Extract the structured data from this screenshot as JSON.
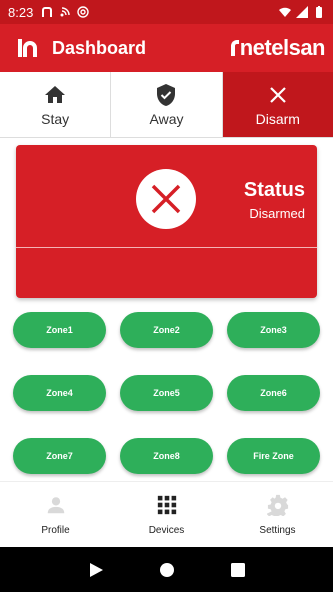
{
  "status_bar": {
    "time": "8:23",
    "left_icons": [
      "n-logo-icon",
      "wifi-small-icon",
      "at-sign-icon"
    ],
    "right_icons": [
      "wifi-icon",
      "signal-icon",
      "battery-icon"
    ]
  },
  "app_bar": {
    "title": "Dashboard",
    "brand": "netelsan",
    "colors": {
      "primary": "#d61f26",
      "dark": "#c0171c"
    }
  },
  "modes": [
    {
      "label": "Stay",
      "icon": "home-icon",
      "active": false
    },
    {
      "label": "Away",
      "icon": "shield-check-icon",
      "active": false
    },
    {
      "label": "Disarm",
      "icon": "close-icon",
      "active": true
    }
  ],
  "status": {
    "title": "Status",
    "value": "Disarmed",
    "icon": "x-circle-icon"
  },
  "zones": [
    [
      "Zone1",
      "Zone2",
      "Zone3"
    ],
    [
      "Zone4",
      "Zone5",
      "Zone6"
    ],
    [
      "Zone7",
      "Zone8",
      "Fire Zone"
    ]
  ],
  "zone_color": "#2eaf5a",
  "bottom_nav": [
    {
      "label": "Profile",
      "icon": "person-icon"
    },
    {
      "label": "Devices",
      "icon": "grid-icon"
    },
    {
      "label": "Settings",
      "icon": "gear-icon"
    }
  ],
  "system_nav": [
    "back-icon",
    "home-circle-icon",
    "recents-icon"
  ]
}
